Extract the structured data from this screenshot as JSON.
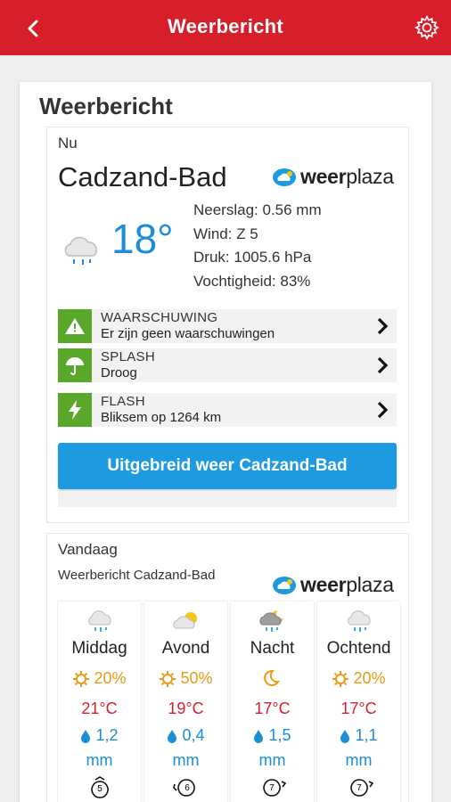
{
  "appbar": {
    "title": "Weerbericht",
    "back_icon": "back-arrow-icon",
    "settings_icon": "gear-icon"
  },
  "card": {
    "title": "Weerbericht"
  },
  "now": {
    "label": "Nu",
    "city": "Cadzand-Bad",
    "logo": {
      "part1": "weer",
      "part2": "plaza"
    },
    "temperature": "18°",
    "condition_icon": "cloud-rain-icon",
    "details": {
      "neerslag_label": "Neerslag:",
      "neerslag_value": "0.56 mm",
      "wind_label": "Wind:",
      "wind_value": "Z 5",
      "druk_label": "Druk:",
      "druk_value": "1005.6 hPa",
      "vocht_label": "Vochtigheid:",
      "vocht_value": "83%"
    },
    "alerts": [
      {
        "title": "WAARSCHUWING",
        "text": "Er zijn geen waarschuwingen",
        "icon": "warning-icon"
      },
      {
        "title": "SPLASH",
        "text": "Droog",
        "icon": "umbrella-icon"
      },
      {
        "title": "FLASH",
        "text": "Bliksem op 1264 km",
        "icon": "lightning-icon"
      }
    ],
    "cta": "Uitgebreid weer Cadzand-Bad"
  },
  "today": {
    "label": "Vandaag",
    "forecast_title": "Weerbericht Cadzand-Bad",
    "logo": {
      "part1": "weer",
      "part2": "plaza"
    },
    "periods": [
      {
        "name": "Middag",
        "icon": "cloud-rain-icon",
        "precip_chance": "20%",
        "temp": "21°C",
        "rain": "1,2",
        "unit": "mm",
        "wind": "5"
      },
      {
        "name": "Avond",
        "icon": "sun-cloud-icon",
        "precip_chance": "50%",
        "temp": "19°C",
        "rain": "0,4",
        "unit": "mm",
        "wind": "6"
      },
      {
        "name": "Nacht",
        "icon": "moon-cloud-rain-icon",
        "precip_chance": "",
        "temp": "17°C",
        "rain": "1,5",
        "unit": "mm",
        "wind": "7"
      },
      {
        "name": "Ochtend",
        "icon": "cloud-rain-icon",
        "precip_chance": "20%",
        "temp": "17°C",
        "rain": "1,1",
        "unit": "mm",
        "wind": "7"
      }
    ]
  },
  "colors": {
    "primary_red": "#d71f2b",
    "accent_blue": "#1e9ae0",
    "alert_green": "#5aa829",
    "sun_orange": "#e99a14"
  }
}
